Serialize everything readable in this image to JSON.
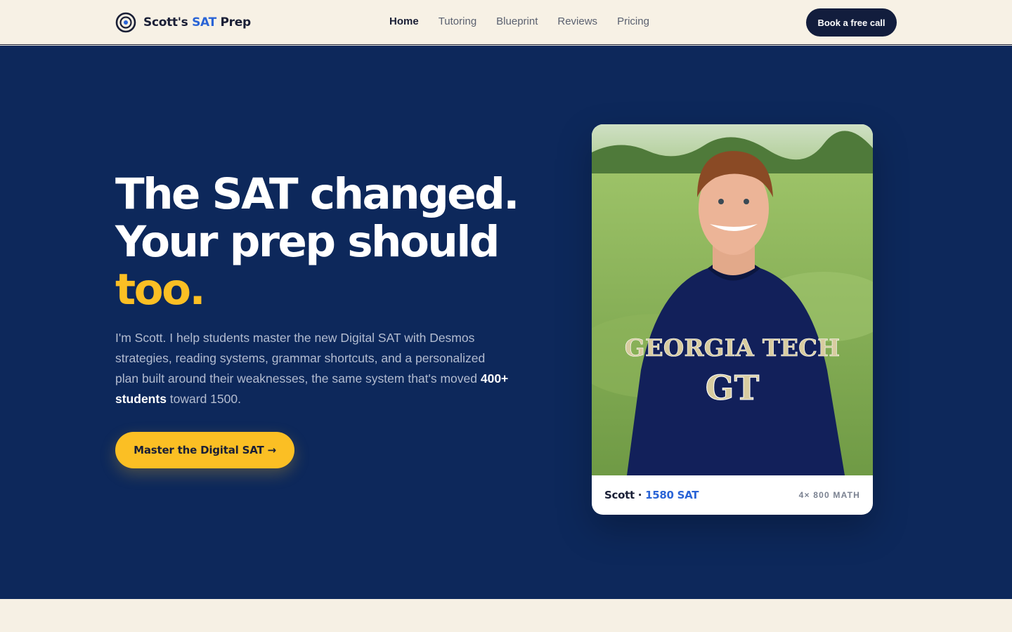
{
  "colors": {
    "navy": "#0d285b",
    "nav_bg": "#f7f1e5",
    "accent_yellow": "#fbbf24",
    "accent_blue": "#2a64d6",
    "dark_button": "#121d3d"
  },
  "header": {
    "logo_icon": "target-icon",
    "brand_name": "Scott's",
    "brand_accent": "SAT",
    "brand_suffix": "Prep",
    "nav": [
      {
        "label": "Home",
        "active": true
      },
      {
        "label": "Tutoring",
        "active": false
      },
      {
        "label": "Blueprint",
        "active": false
      },
      {
        "label": "Reviews",
        "active": false
      },
      {
        "label": "Pricing",
        "active": false
      }
    ],
    "cta_label": "Book a free call"
  },
  "hero": {
    "headline_line1": "The SAT changed.",
    "headline_line2": "Your prep should",
    "headline_line3": "too.",
    "lede_before": "I'm Scott. I help students master the new Digital SAT with Desmos strategies, reading systems, grammar shortcuts, and a personalized plan built around their weaknesses, the same system that's moved ",
    "lede_strong": "400+ students",
    "lede_after": " toward 1500.",
    "cta_label": "Master the Digital SAT →"
  },
  "profile_card": {
    "photo_icon": "student-portrait",
    "shirt_text": "GEORGIA TECH",
    "shirt_logo": "GT",
    "name": "Scott ·",
    "score": "1580 SAT",
    "badge": "4× 800 MATH"
  }
}
